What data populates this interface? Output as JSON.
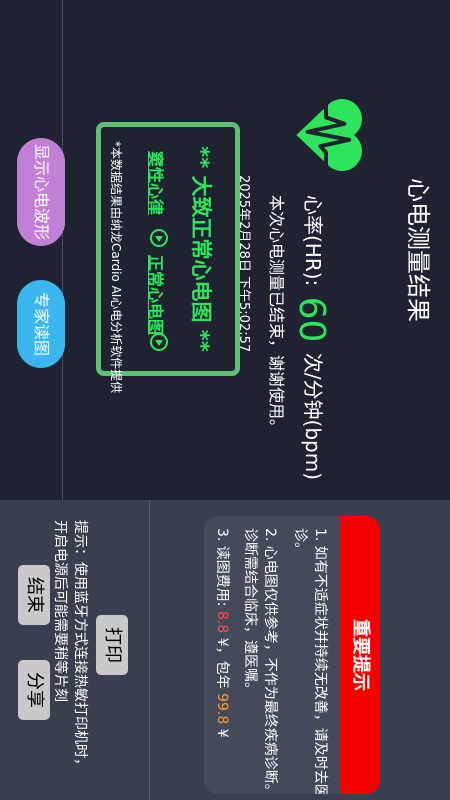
{
  "title": "心电测量结果",
  "heart_rate": {
    "label": "心率(HR):",
    "value": "60",
    "unit": "次/分钟(bpm)"
  },
  "done_text": "本次心电测量已结束，谢谢使用。",
  "datetime": "2025年2月28日 下午5:02:57",
  "result": {
    "diagnosis": "** 大致正常心电图 **",
    "tags": [
      "窦性心律",
      "正常心电图"
    ],
    "footnote": "*本数据结果由纳龙Cardio AI心电分析软件提供"
  },
  "buttons": {
    "wave": "显示心电波形",
    "expert": "专家读图",
    "print": "打印",
    "end": "结束",
    "share": "分享"
  },
  "notice": {
    "header": "重要提示",
    "item1_line1": "1. 如有不适症状并持续无改善，请及时去医院就",
    "item1_line2": "诊。",
    "item2_line1": "2. 心电图仅供参考，不作为最终疾病诊断。疾病",
    "item2_line2": "诊断需结合临床，遵医嘱。",
    "item3_prefix": "3. 读图费用:",
    "item3_fee1": "8.8",
    "item3_mid": "¥，包年",
    "item3_fee2": "99.8",
    "item3_suffix": "¥"
  },
  "tip": {
    "line1": "提示：使用蓝牙方式连接热敏打印机时，",
    "line2": "开启电源后可能需要稍等片刻"
  },
  "colors": {
    "accent_green": "#2ee45a",
    "notice_red": "#f50000",
    "wave_button": "#c27fd6",
    "expert_button": "#3bb7ef"
  }
}
